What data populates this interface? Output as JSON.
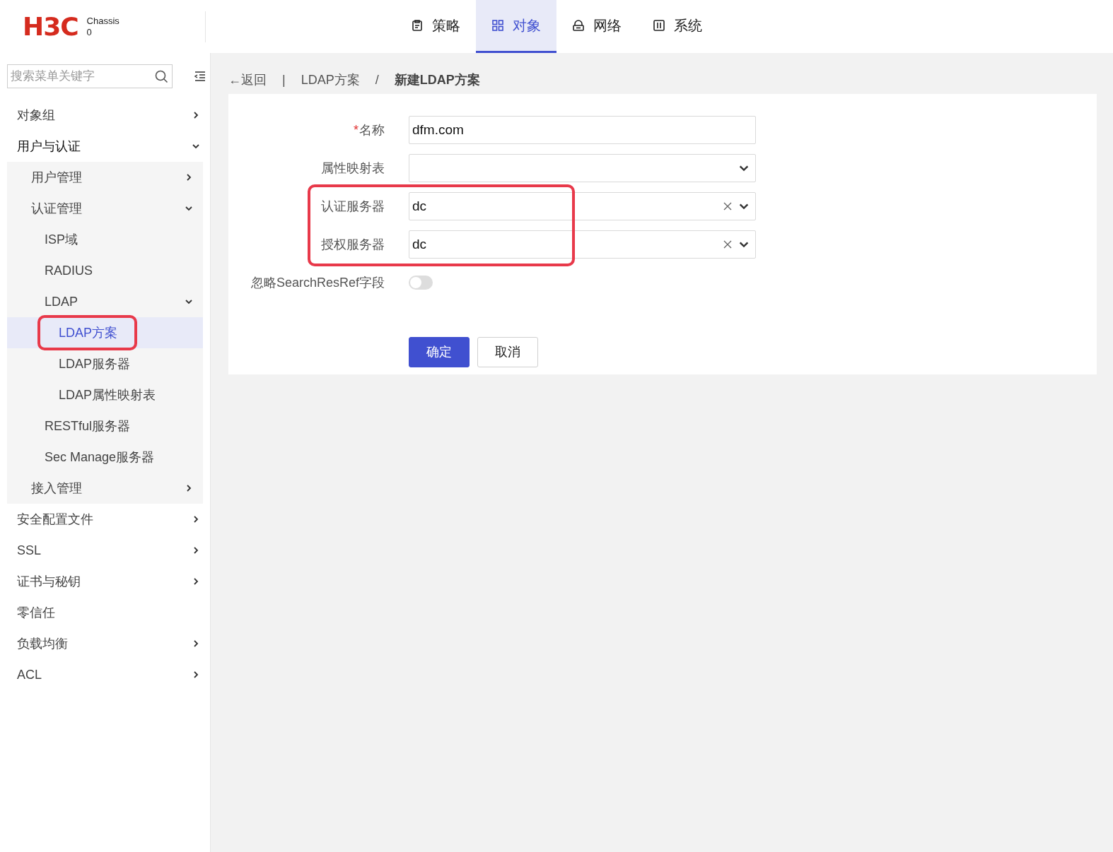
{
  "header": {
    "logo": "H3C",
    "device_name": "Chassis",
    "device_slot": "0",
    "tabs": [
      {
        "label": "策略",
        "selected": false
      },
      {
        "label": "对象",
        "selected": true
      },
      {
        "label": "网络",
        "selected": false
      },
      {
        "label": "系统",
        "selected": false
      }
    ]
  },
  "sidebar": {
    "search": {
      "placeholder": "搜索菜单关键字"
    },
    "items": [
      {
        "label": "对象组",
        "kind": "folder",
        "expanded": false,
        "selected": false,
        "highlighted": false
      },
      {
        "label": "用户与认证",
        "kind": "folder",
        "expanded": true,
        "selected": false,
        "highlighted": false,
        "children": [
          {
            "label": "用户管理",
            "kind": "folder",
            "expanded": false,
            "selected": false,
            "highlighted": false
          },
          {
            "label": "认证管理",
            "kind": "folder",
            "expanded": true,
            "selected": false,
            "highlighted": false,
            "children": [
              {
                "label": "ISP域",
                "kind": "page",
                "selected": false,
                "highlighted": false
              },
              {
                "label": "RADIUS",
                "kind": "page",
                "selected": false,
                "highlighted": false
              },
              {
                "label": "LDAP",
                "kind": "folder",
                "expanded": true,
                "selected": false,
                "highlighted": false,
                "children": [
                  {
                    "label": "LDAP方案",
                    "kind": "page",
                    "selected": true,
                    "highlighted": true
                  },
                  {
                    "label": "LDAP服务器",
                    "kind": "page",
                    "selected": false,
                    "highlighted": false
                  },
                  {
                    "label": "LDAP属性映射表",
                    "kind": "page",
                    "selected": false,
                    "highlighted": false
                  }
                ]
              },
              {
                "label": "RESTful服务器",
                "kind": "page",
                "selected": false,
                "highlighted": false
              },
              {
                "label": "Sec Manage服务器",
                "kind": "page",
                "selected": false,
                "highlighted": false
              }
            ]
          },
          {
            "label": "接入管理",
            "kind": "folder",
            "expanded": false,
            "selected": false,
            "highlighted": false
          }
        ]
      },
      {
        "label": "安全配置文件",
        "kind": "folder",
        "expanded": false,
        "selected": false,
        "highlighted": false
      },
      {
        "label": "SSL",
        "kind": "folder",
        "expanded": false,
        "selected": false,
        "highlighted": false
      },
      {
        "label": "证书与秘钥",
        "kind": "folder",
        "expanded": false,
        "selected": false,
        "highlighted": false
      },
      {
        "label": "零信任",
        "kind": "page",
        "selected": false,
        "highlighted": false
      },
      {
        "label": "负载均衡",
        "kind": "folder",
        "expanded": false,
        "selected": false,
        "highlighted": false
      },
      {
        "label": "ACL",
        "kind": "folder",
        "expanded": false,
        "selected": false,
        "highlighted": false
      }
    ]
  },
  "breadcrumb": {
    "back": "←返回",
    "separator": "|",
    "items": [
      "LDAP方案",
      "新建LDAP方案"
    ],
    "divider": "/"
  },
  "form": {
    "required_mark": "*",
    "fields": [
      {
        "label": "名称",
        "required": true,
        "kind": "text",
        "value": "dfm.com",
        "highlighted": false
      },
      {
        "label": "属性映射表",
        "required": false,
        "kind": "select",
        "clearable": false,
        "highlighted": false
      },
      {
        "label": "认证服务器",
        "required": false,
        "kind": "select",
        "value": "dc",
        "clearable": true,
        "highlighted": true
      },
      {
        "label": "授权服务器",
        "required": false,
        "kind": "select",
        "value": "dc",
        "clearable": true,
        "highlighted": true
      },
      {
        "label": "忽略SearchResRef字段",
        "required": false,
        "kind": "switch",
        "on": false,
        "highlighted": false
      }
    ],
    "buttons": [
      {
        "label": "确定",
        "kind": "primary"
      },
      {
        "label": "取消",
        "kind": "default"
      }
    ]
  }
}
